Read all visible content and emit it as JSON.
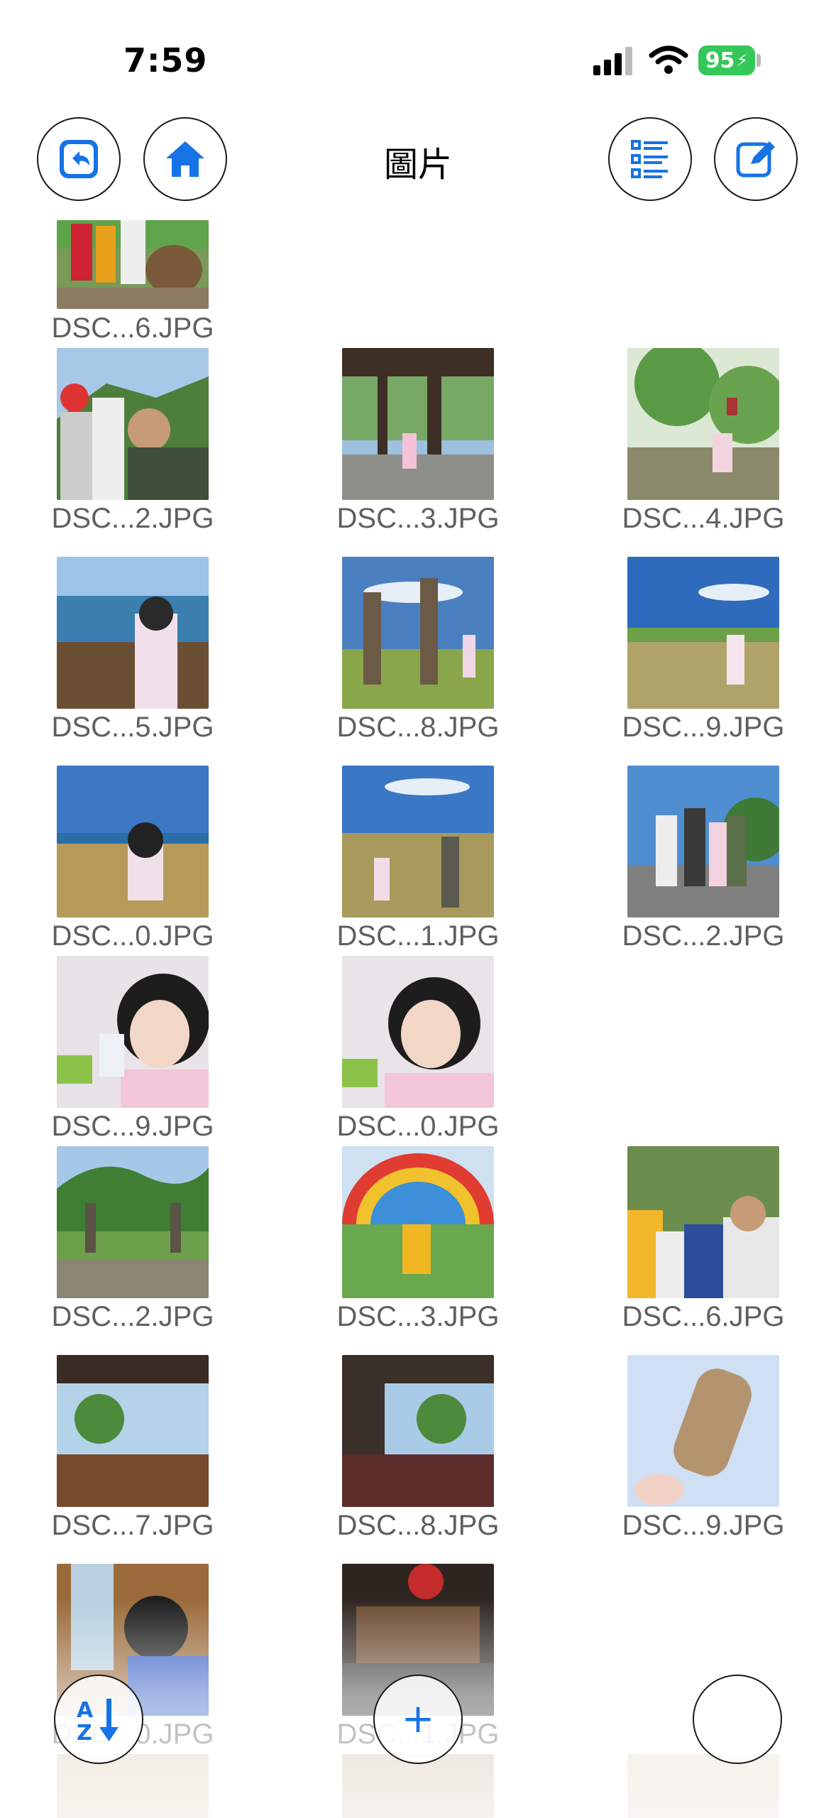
{
  "status_bar": {
    "time": "7:59",
    "battery": "95"
  },
  "nav": {
    "title": "圖片",
    "back_icon": "back-arrow-icon",
    "home_icon": "house-icon",
    "list_icon": "list-icon",
    "edit_icon": "edit-square-icon"
  },
  "photos": [
    {
      "name": "DSC...6.JPG"
    },
    {
      "name": "DSC...2.JPG"
    },
    {
      "name": "DSC...3.JPG"
    },
    {
      "name": "DSC...4.JPG"
    },
    {
      "name": "DSC...5.JPG"
    },
    {
      "name": "DSC...8.JPG"
    },
    {
      "name": "DSC...9.JPG"
    },
    {
      "name": "DSC...0.JPG"
    },
    {
      "name": "DSC...1.JPG"
    },
    {
      "name": "DSC...2.JPG"
    },
    {
      "name": "DSC...9.JPG"
    },
    {
      "name": "DSC...0.JPG"
    },
    {
      "name": "DSC...2.JPG"
    },
    {
      "name": "DSC...3.JPG"
    },
    {
      "name": "DSC...6.JPG"
    },
    {
      "name": "DSC...7.JPG"
    },
    {
      "name": "DSC...8.JPG"
    },
    {
      "name": "DSC...9.JPG"
    },
    {
      "name": "DSC...0.JPG"
    },
    {
      "name": "DSC...1.JPG"
    }
  ],
  "bottom_bar": {
    "sort_icon": "sort-az-icon",
    "add_label": "+"
  },
  "colors": {
    "accent": "#1673e6",
    "battery": "#34c759",
    "filename": "#5f5f5f"
  }
}
